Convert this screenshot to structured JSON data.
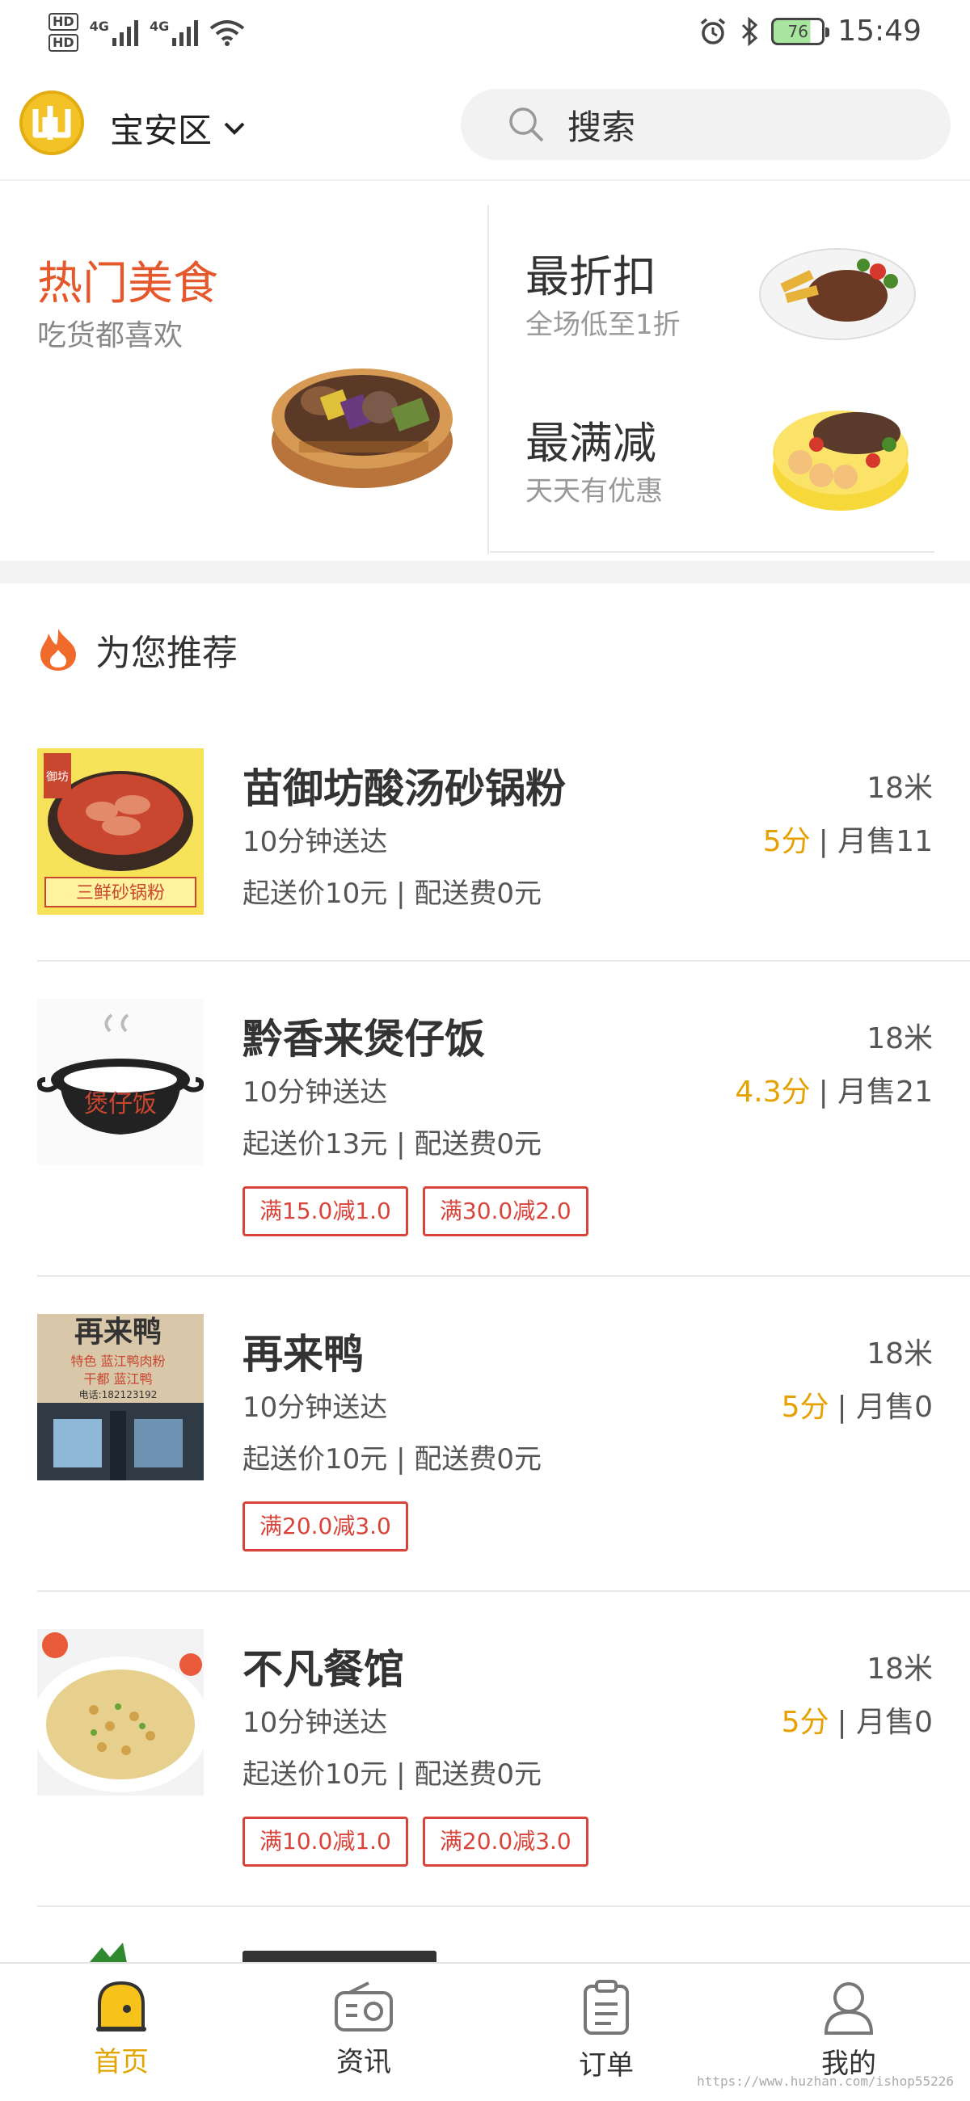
{
  "status_bar": {
    "hd1": "HD",
    "hd2": "HD",
    "net1": "4G",
    "net2": "4G",
    "battery": "76",
    "time": "15:49"
  },
  "header": {
    "location": "宝安区",
    "search_placeholder": "搜索"
  },
  "promo": {
    "hot": {
      "title": "热门美食",
      "subtitle": "吃货都喜欢"
    },
    "discount": {
      "title": "最折扣",
      "subtitle": "全场低至1折"
    },
    "full_reduction": {
      "title": "最满减",
      "subtitle": "天天有优惠"
    }
  },
  "recommend": {
    "title": "为您推荐"
  },
  "shops": [
    {
      "name": "苗御坊酸汤砂锅粉",
      "distance": "18米",
      "delivery_time": "10分钟送达",
      "score": "5分",
      "monthly_sales": "| 月售11",
      "fees": "起送价10元 | 配送费0元",
      "badges": []
    },
    {
      "name": "黔香来煲仔饭",
      "distance": "18米",
      "delivery_time": "10分钟送达",
      "score": "4.3分",
      "monthly_sales": "| 月售21",
      "fees": "起送价13元 | 配送费0元",
      "badges": [
        "满15.0减1.0",
        "满30.0减2.0"
      ]
    },
    {
      "name": "再来鸭",
      "distance": "18米",
      "delivery_time": "10分钟送达",
      "score": "5分",
      "monthly_sales": "| 月售0",
      "fees": "起送价10元 | 配送费0元",
      "badges": [
        "满20.0减3.0"
      ]
    },
    {
      "name": "不凡餐馆",
      "distance": "18米",
      "delivery_time": "10分钟送达",
      "score": "5分",
      "monthly_sales": "| 月售0",
      "fees": "起送价10元 | 配送费0元",
      "badges": [
        "满10.0减1.0",
        "满20.0减3.0"
      ]
    }
  ],
  "shop_images": {
    "shop1_caption": "三鲜砂锅粉",
    "shop1_tag": "御坊",
    "shop2_logo": "煲仔饭",
    "shop3_sign": "再来鸭",
    "shop3_sub": "特色 蓝江鸭肉粉",
    "shop3_sub2": "干都 蓝江鸭",
    "shop3_phone": "电话:182123192"
  },
  "tabs": [
    {
      "label": "首页",
      "icon": "home-icon",
      "active": true
    },
    {
      "label": "资讯",
      "icon": "radio-icon",
      "active": false
    },
    {
      "label": "订单",
      "icon": "clipboard-icon",
      "active": false
    },
    {
      "label": "我的",
      "icon": "user-icon",
      "active": false
    }
  ],
  "watermark": "https://www.huzhan.com/ishop55226",
  "colors": {
    "accent": "#e2a400",
    "hot_title": "#e5582c",
    "badge": "#d9443a",
    "score": "#e6a000"
  }
}
